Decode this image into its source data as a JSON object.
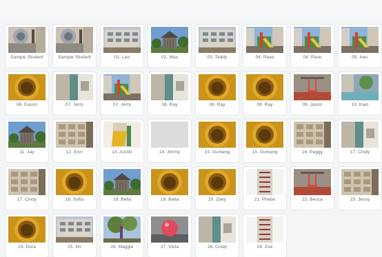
{
  "gallery": {
    "items": [
      {
        "name": "Sample Student",
        "photo": "camera-closeup"
      },
      {
        "name": "Sample Student",
        "photo": "camera-closeup"
      },
      {
        "name": "01. Leo",
        "photo": "building"
      },
      {
        "name": "02. Max",
        "photo": "shelter"
      },
      {
        "name": "03. Teddy",
        "photo": "building"
      },
      {
        "name": "04. Rave",
        "photo": "playground"
      },
      {
        "name": "04. Rave",
        "photo": "playground"
      },
      {
        "name": "05. Ives",
        "photo": "playground"
      },
      {
        "name": "06. Eason",
        "photo": "tube"
      },
      {
        "name": "07. Jerry",
        "photo": "pillar"
      },
      {
        "name": "07. Jerry",
        "photo": "playground"
      },
      {
        "name": "08. Ray",
        "photo": "pillar"
      },
      {
        "name": "08. Ray",
        "photo": "tube"
      },
      {
        "name": "08. Ray",
        "photo": "tube"
      },
      {
        "name": "09. Jason",
        "photo": "swing"
      },
      {
        "name": "10. Kain",
        "photo": "pool"
      },
      {
        "name": "11. Jay",
        "photo": "shelter"
      },
      {
        "name": "12. Enrr",
        "photo": "wall"
      },
      {
        "name": "13. Austin",
        "photo": "slide"
      },
      {
        "name": "14. Jimmy",
        "photo": "blank"
      },
      {
        "name": "15. Gumeng",
        "photo": "tube"
      },
      {
        "name": "15. Gumeng",
        "photo": "tube"
      },
      {
        "name": "16. Peggy",
        "photo": "wall"
      },
      {
        "name": "17. Cindy",
        "photo": "pillar"
      },
      {
        "name": "17. Cindy",
        "photo": "wall"
      },
      {
        "name": "18. Sofia",
        "photo": "tube"
      },
      {
        "name": "19. Bella",
        "photo": "shelter"
      },
      {
        "name": "19. Bella",
        "photo": "tube"
      },
      {
        "name": "20. Zoey",
        "photo": "tube"
      },
      {
        "name": "21. Phebe",
        "photo": "tower"
      },
      {
        "name": "22. Becca",
        "photo": "swing"
      },
      {
        "name": "23. Jessy",
        "photo": "wall"
      },
      {
        "name": "24. Dora",
        "photo": "tube"
      },
      {
        "name": "25. Iiin",
        "photo": "building"
      },
      {
        "name": "26. Maggie",
        "photo": "tree"
      },
      {
        "name": "27. Viola",
        "photo": "ball"
      },
      {
        "name": "28. Cindy",
        "photo": "pillar"
      },
      {
        "name": "29. Zoe",
        "photo": "tower"
      }
    ]
  }
}
